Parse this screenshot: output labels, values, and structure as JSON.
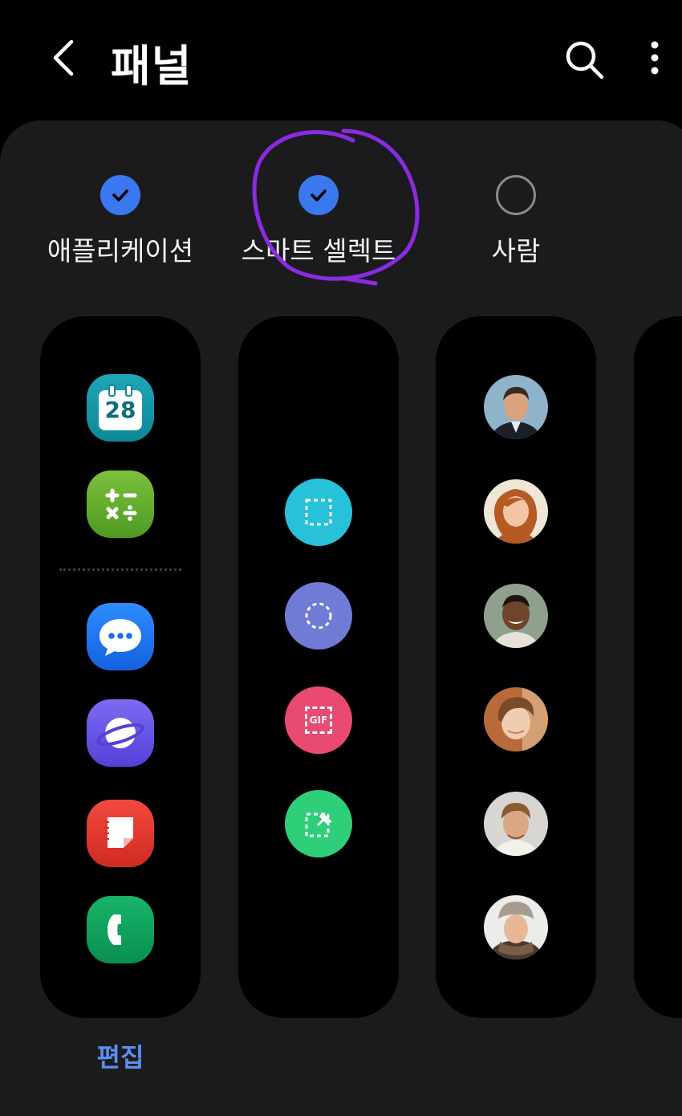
{
  "appbar": {
    "title": "패널",
    "back_icon": "back-arrow-icon",
    "search_icon": "search-icon",
    "more_icon": "more-vert-icon"
  },
  "panels": [
    {
      "label": "애플리케이션",
      "checked": true
    },
    {
      "label": "스마트 셀렉트",
      "checked": true
    },
    {
      "label": "사람",
      "checked": false
    },
    {
      "label": "",
      "checked": false
    }
  ],
  "apps_panel": {
    "icons": [
      "calendar-icon",
      "calculator-icon",
      "messages-icon",
      "internet-browser-icon",
      "notes-icon",
      "phone-icon"
    ],
    "calendar_day": "28"
  },
  "smart_select_panel": {
    "tools": [
      "rectangle-select-icon",
      "oval-select-icon",
      "animation-gif-icon",
      "pin-to-screen-icon"
    ],
    "gif_label": "GIF"
  },
  "people_panel": {
    "contacts": 6
  },
  "edit_label": "편집",
  "colors": {
    "accent": "#3b78f0",
    "edit": "#5a8ff0",
    "annotation": "#8a2be2",
    "sheet": "#1b1b1d"
  }
}
